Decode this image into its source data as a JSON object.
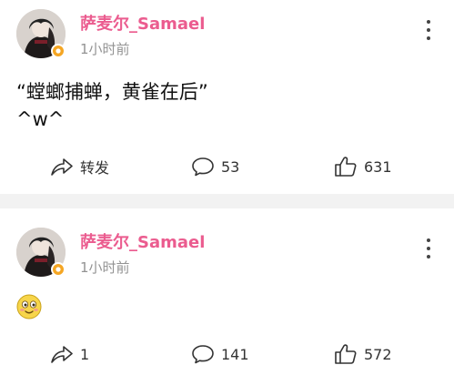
{
  "posts": [
    {
      "username": "萨麦尔_Samael",
      "time": "1小时前",
      "text_line1": "“螳螂捕蝉，黄雀在后”",
      "text_line2": "^w^",
      "repost": "转发",
      "comments": "53",
      "likes": "631",
      "avatar_icon": "avatar-image",
      "badge_icon": "verified-badge-icon"
    },
    {
      "username": "萨麦尔_Samael",
      "time": "1小时前",
      "content_icon": "smiling-face-emoji",
      "repost": "1",
      "comments": "141",
      "likes": "572",
      "avatar_icon": "avatar-image",
      "badge_icon": "verified-badge-icon"
    }
  ],
  "colors": {
    "username": "#eb5c8f",
    "timestamp": "#939393",
    "badge": "#f5a623",
    "divider": "#f2f2f2"
  }
}
